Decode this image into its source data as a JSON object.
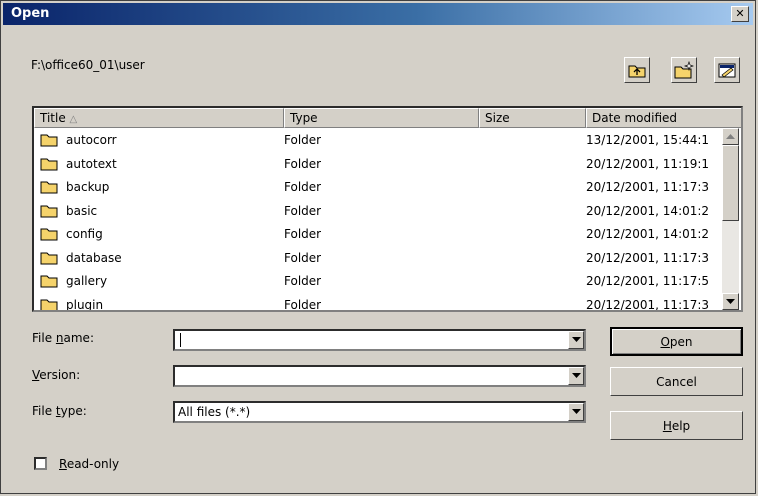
{
  "window": {
    "title": "Open",
    "close_glyph": "✕"
  },
  "path": "F:\\office60_01\\user",
  "toolbar": {
    "buttons": [
      {
        "icon": "folder-up-icon"
      },
      {
        "icon": "new-folder-icon"
      },
      {
        "icon": "default-directory-icon"
      }
    ]
  },
  "list": {
    "columns": [
      {
        "label": "Title",
        "sort_glyph": "△"
      },
      {
        "label": "Type"
      },
      {
        "label": "Size"
      },
      {
        "label": "Date modified"
      }
    ],
    "rows": [
      {
        "name": "autocorr",
        "type": "Folder",
        "size": "",
        "date": "13/12/2001, 15:44:1"
      },
      {
        "name": "autotext",
        "type": "Folder",
        "size": "",
        "date": "20/12/2001, 11:19:1"
      },
      {
        "name": "backup",
        "type": "Folder",
        "size": "",
        "date": "20/12/2001, 11:17:3"
      },
      {
        "name": "basic",
        "type": "Folder",
        "size": "",
        "date": "20/12/2001, 14:01:2"
      },
      {
        "name": "config",
        "type": "Folder",
        "size": "",
        "date": "20/12/2001, 14:01:2"
      },
      {
        "name": "database",
        "type": "Folder",
        "size": "",
        "date": "20/12/2001, 11:17:3"
      },
      {
        "name": "gallery",
        "type": "Folder",
        "size": "",
        "date": "20/12/2001, 11:17:5"
      },
      {
        "name": "plugin",
        "type": "Folder",
        "size": "",
        "date": "20/12/2001, 11:17:3"
      }
    ]
  },
  "form": {
    "file_name": {
      "label_pre": "File ",
      "label_accel": "n",
      "label_post": "ame:",
      "value": ""
    },
    "version": {
      "label_pre": "",
      "label_accel": "V",
      "label_post": "ersion:",
      "value": ""
    },
    "file_type": {
      "label_pre": "File ",
      "label_accel": "t",
      "label_post": "ype:",
      "value": "All files (*.*)"
    }
  },
  "buttons": {
    "open": {
      "accel": "O",
      "rest": "pen"
    },
    "cancel": {
      "label": "Cancel"
    },
    "help": {
      "accel": "H",
      "rest": "elp"
    }
  },
  "read_only": {
    "accel": "R",
    "rest": "ead-only",
    "checked": false
  },
  "colors": {
    "face": "#d4d0c8",
    "title_start": "#0a246a",
    "title_end": "#a6caf0",
    "folder": "#f5d36b"
  }
}
